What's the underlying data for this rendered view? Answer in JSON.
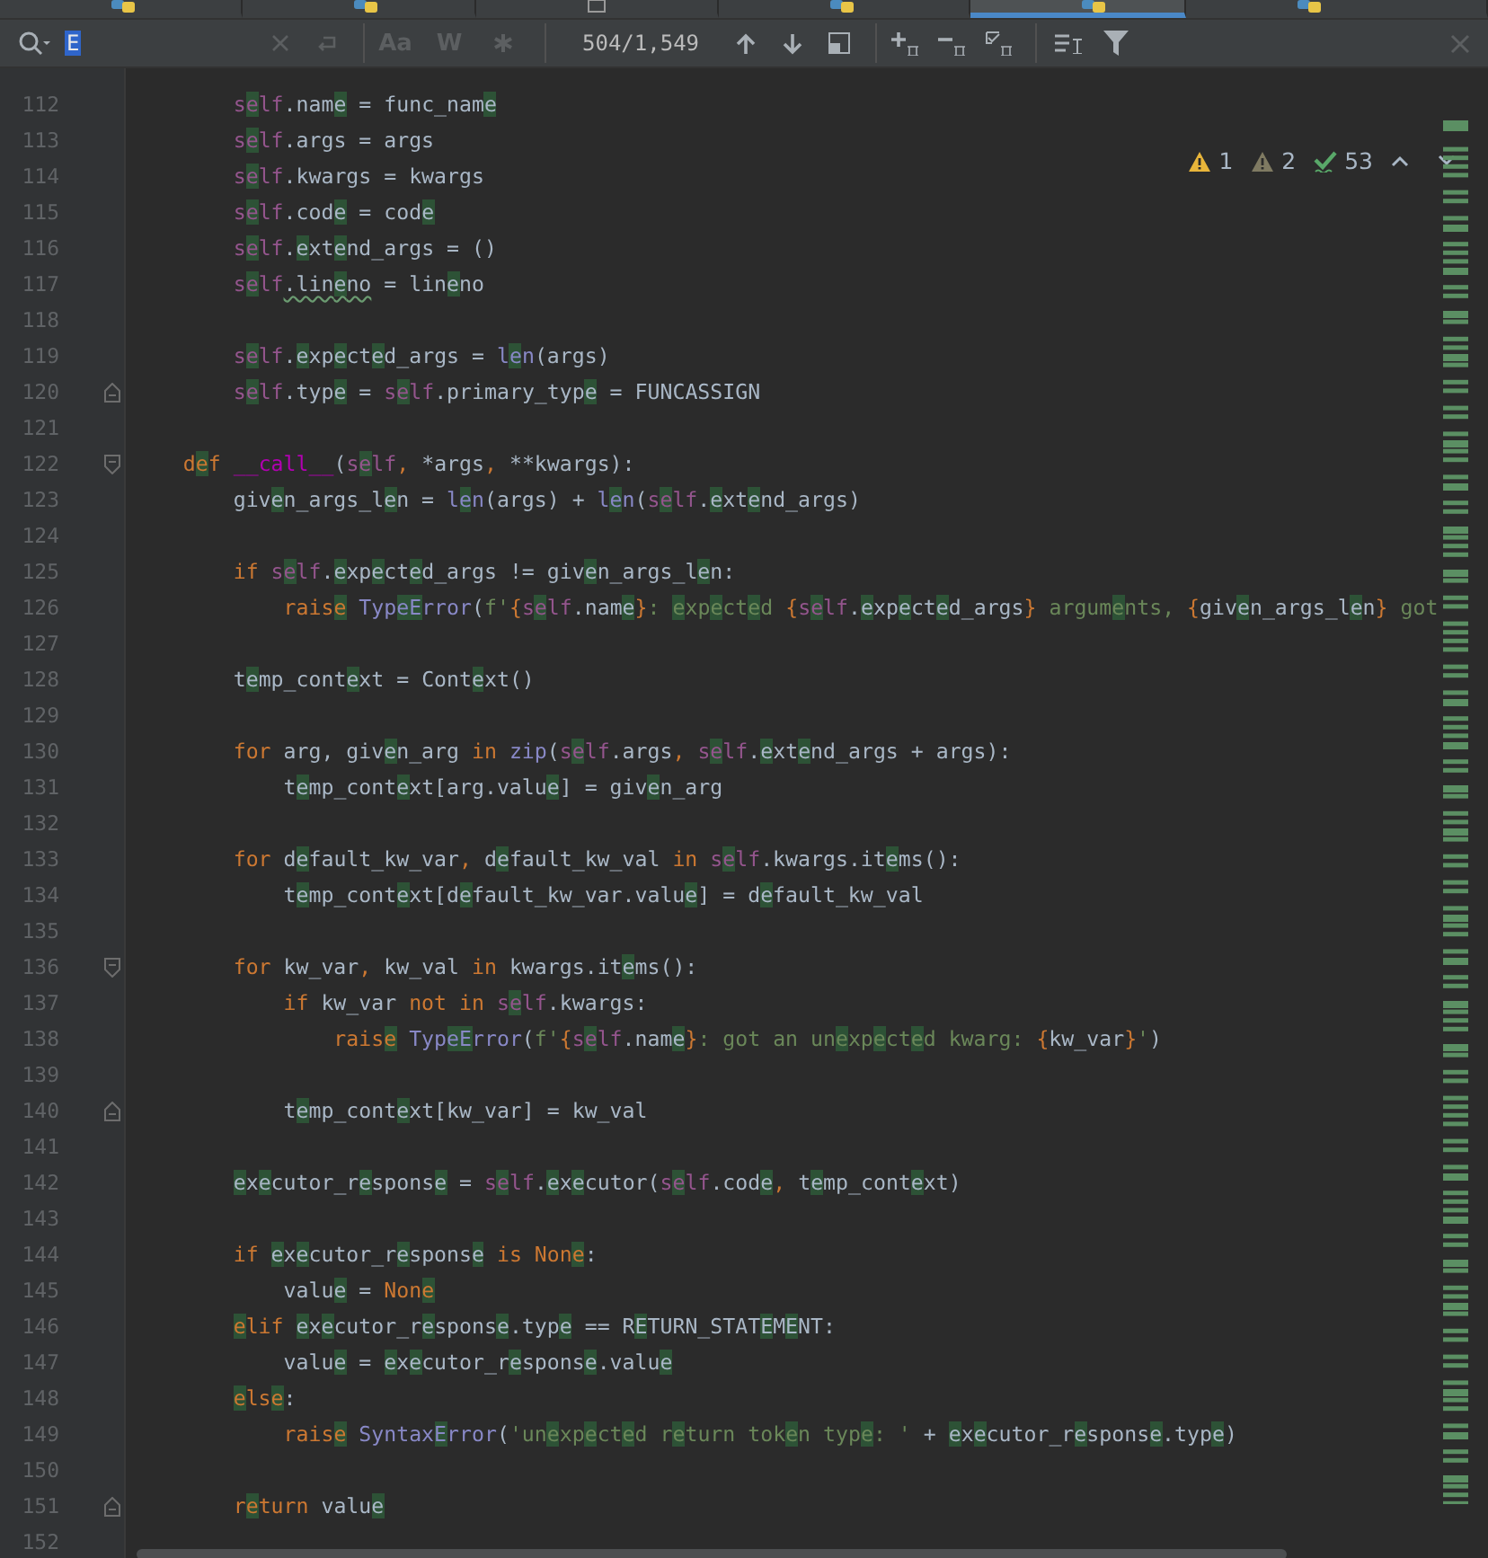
{
  "tabs": [
    {
      "kind": "python",
      "selected": false
    },
    {
      "kind": "python",
      "selected": false
    },
    {
      "kind": "text",
      "selected": false
    },
    {
      "kind": "python",
      "selected": false
    },
    {
      "kind": "python",
      "selected": true
    },
    {
      "kind": "python",
      "selected": false
    }
  ],
  "search": {
    "value": "E",
    "options": [
      {
        "kind": "text",
        "label": "Aa",
        "on": false
      },
      {
        "kind": "text",
        "label": "W",
        "on": false
      },
      {
        "kind": "regex",
        "on": false
      }
    ],
    "counter": "504/1,549"
  },
  "inspections": [
    {
      "kind": "warning",
      "count": "1"
    },
    {
      "kind": "weak",
      "count": "2"
    },
    {
      "kind": "typo",
      "count": "53"
    }
  ],
  "lines": [
    {
      "number": "112",
      "tokens": [
        {
          "kind": "self",
          "text": "        self"
        },
        {
          "kind": "plain",
          "text": ".name = func_name"
        }
      ]
    },
    {
      "number": "113",
      "tokens": [
        {
          "kind": "self",
          "text": "        self"
        },
        {
          "kind": "plain",
          "text": ".args = args"
        }
      ]
    },
    {
      "number": "114",
      "tokens": [
        {
          "kind": "self",
          "text": "        self"
        },
        {
          "kind": "plain",
          "text": ".kwargs = kwargs"
        }
      ]
    },
    {
      "number": "115",
      "tokens": [
        {
          "kind": "self",
          "text": "        self"
        },
        {
          "kind": "plain",
          "text": ".code = code"
        }
      ]
    },
    {
      "number": "116",
      "tokens": [
        {
          "kind": "self",
          "text": "        self"
        },
        {
          "kind": "plain",
          "text": ".extend_args = ()"
        }
      ]
    },
    {
      "number": "117",
      "tokens": [
        {
          "kind": "self",
          "text": "        self"
        },
        {
          "kind": "warn",
          "text": ".lineno"
        },
        {
          "kind": "plain",
          "text": " = lineno"
        }
      ]
    },
    {
      "number": "118"
    },
    {
      "number": "119",
      "tokens": [
        {
          "kind": "self",
          "text": "        self"
        },
        {
          "kind": "plain",
          "text": ".expected_args = "
        },
        {
          "kind": "builtin",
          "text": "len"
        },
        {
          "kind": "plain",
          "text": "(args)"
        }
      ]
    },
    {
      "number": "120",
      "kind": "fold-end",
      "tokens": [
        {
          "kind": "self",
          "text": "        self"
        },
        {
          "kind": "plain",
          "text": ".type = "
        },
        {
          "kind": "self",
          "text": "self"
        },
        {
          "kind": "plain",
          "text": ".primary_type = FUNCASSIGN"
        }
      ]
    },
    {
      "number": "121"
    },
    {
      "number": "122",
      "kind": "fold-start",
      "tokens": [
        {
          "kind": "keyword",
          "text": "    def "
        },
        {
          "kind": "magic",
          "text": "__call__"
        },
        {
          "kind": "plain",
          "text": "("
        },
        {
          "kind": "self",
          "text": "self"
        },
        {
          "kind": "keyword",
          "text": ", "
        },
        {
          "kind": "plain",
          "text": "*args"
        },
        {
          "kind": "keyword",
          "text": ", "
        },
        {
          "kind": "plain",
          "text": "**kwargs):"
        }
      ]
    },
    {
      "number": "123",
      "tokens": [
        {
          "kind": "plain",
          "text": "        given_args_len = "
        },
        {
          "kind": "builtin",
          "text": "len"
        },
        {
          "kind": "plain",
          "text": "(args) + "
        },
        {
          "kind": "builtin",
          "text": "len"
        },
        {
          "kind": "plain",
          "text": "("
        },
        {
          "kind": "self",
          "text": "self"
        },
        {
          "kind": "plain",
          "text": ".extend_args)"
        }
      ]
    },
    {
      "number": "124"
    },
    {
      "number": "125",
      "tokens": [
        {
          "kind": "keyword",
          "text": "        if "
        },
        {
          "kind": "self",
          "text": "self"
        },
        {
          "kind": "plain",
          "text": ".expected_args != given_args_len:"
        }
      ]
    },
    {
      "number": "126",
      "tokens": [
        {
          "kind": "keyword",
          "text": "            raise "
        },
        {
          "kind": "builtin",
          "text": "TypeError"
        },
        {
          "kind": "plain",
          "text": "("
        },
        {
          "kind": "string",
          "text": "f'"
        },
        {
          "kind": "keyword",
          "text": "{"
        },
        {
          "kind": "self",
          "text": "self"
        },
        {
          "kind": "plain",
          "text": ".name"
        },
        {
          "kind": "keyword",
          "text": "}"
        },
        {
          "kind": "string",
          "text": ": expected "
        },
        {
          "kind": "keyword",
          "text": "{"
        },
        {
          "kind": "self",
          "text": "self"
        },
        {
          "kind": "plain",
          "text": ".expected_args"
        },
        {
          "kind": "keyword",
          "text": "}"
        },
        {
          "kind": "string",
          "text": " arguments, "
        },
        {
          "kind": "keyword",
          "text": "{"
        },
        {
          "kind": "plain",
          "text": "given_args_len"
        },
        {
          "kind": "keyword",
          "text": "}"
        },
        {
          "kind": "string",
          "text": " got"
        }
      ]
    },
    {
      "number": "127"
    },
    {
      "number": "128",
      "tokens": [
        {
          "kind": "plain",
          "text": "        temp_context = Context()"
        }
      ]
    },
    {
      "number": "129"
    },
    {
      "number": "130",
      "tokens": [
        {
          "kind": "keyword",
          "text": "        for "
        },
        {
          "kind": "plain",
          "text": "arg, given_arg "
        },
        {
          "kind": "keyword",
          "text": "in "
        },
        {
          "kind": "builtin",
          "text": "zip"
        },
        {
          "kind": "plain",
          "text": "("
        },
        {
          "kind": "self",
          "text": "self"
        },
        {
          "kind": "plain",
          "text": ".args"
        },
        {
          "kind": "keyword",
          "text": ", "
        },
        {
          "kind": "self",
          "text": "self"
        },
        {
          "kind": "plain",
          "text": ".extend_args + args):"
        }
      ]
    },
    {
      "number": "131",
      "tokens": [
        {
          "kind": "plain",
          "text": "            temp_context[arg.value] = given_arg"
        }
      ]
    },
    {
      "number": "132"
    },
    {
      "number": "133",
      "tokens": [
        {
          "kind": "keyword",
          "text": "        for "
        },
        {
          "kind": "plain",
          "text": "default_kw_var"
        },
        {
          "kind": "keyword",
          "text": ", "
        },
        {
          "kind": "plain",
          "text": "default_kw_val "
        },
        {
          "kind": "keyword",
          "text": "in "
        },
        {
          "kind": "self",
          "text": "self"
        },
        {
          "kind": "plain",
          "text": ".kwargs.items():"
        }
      ]
    },
    {
      "number": "134",
      "tokens": [
        {
          "kind": "plain",
          "text": "            temp_context[default_kw_var.value] = default_kw_val"
        }
      ]
    },
    {
      "number": "135"
    },
    {
      "number": "136",
      "kind": "fold-start",
      "tokens": [
        {
          "kind": "keyword",
          "text": "        for "
        },
        {
          "kind": "plain",
          "text": "kw_var"
        },
        {
          "kind": "keyword",
          "text": ", "
        },
        {
          "kind": "plain",
          "text": "kw_val "
        },
        {
          "kind": "keyword",
          "text": "in "
        },
        {
          "kind": "plain",
          "text": "kwargs.items():"
        }
      ]
    },
    {
      "number": "137",
      "tokens": [
        {
          "kind": "keyword",
          "text": "            if "
        },
        {
          "kind": "plain",
          "text": "kw_var "
        },
        {
          "kind": "keyword",
          "text": "not in "
        },
        {
          "kind": "self",
          "text": "self"
        },
        {
          "kind": "plain",
          "text": ".kwargs:"
        }
      ]
    },
    {
      "number": "138",
      "tokens": [
        {
          "kind": "keyword",
          "text": "                raise "
        },
        {
          "kind": "builtin",
          "text": "TypeError"
        },
        {
          "kind": "plain",
          "text": "("
        },
        {
          "kind": "string",
          "text": "f'"
        },
        {
          "kind": "keyword",
          "text": "{"
        },
        {
          "kind": "self",
          "text": "self"
        },
        {
          "kind": "plain",
          "text": ".name"
        },
        {
          "kind": "keyword",
          "text": "}"
        },
        {
          "kind": "string",
          "text": ": got an unexpected kwarg: "
        },
        {
          "kind": "keyword",
          "text": "{"
        },
        {
          "kind": "plain",
          "text": "kw_var"
        },
        {
          "kind": "keyword",
          "text": "}"
        },
        {
          "kind": "string",
          "text": "'"
        },
        {
          "kind": "plain",
          "text": ")"
        }
      ]
    },
    {
      "number": "139"
    },
    {
      "number": "140",
      "kind": "fold-end",
      "tokens": [
        {
          "kind": "plain",
          "text": "            temp_context[kw_var] = kw_val"
        }
      ]
    },
    {
      "number": "141"
    },
    {
      "number": "142",
      "tokens": [
        {
          "kind": "plain",
          "text": "        executor_response = "
        },
        {
          "kind": "self",
          "text": "self"
        },
        {
          "kind": "plain",
          "text": ".executor("
        },
        {
          "kind": "self",
          "text": "self"
        },
        {
          "kind": "plain",
          "text": ".code"
        },
        {
          "kind": "keyword",
          "text": ", "
        },
        {
          "kind": "plain",
          "text": "temp_context)"
        }
      ]
    },
    {
      "number": "143"
    },
    {
      "number": "144",
      "tokens": [
        {
          "kind": "keyword",
          "text": "        if "
        },
        {
          "kind": "plain",
          "text": "executor_response "
        },
        {
          "kind": "keyword",
          "text": "is None"
        },
        {
          "kind": "plain",
          "text": ":"
        }
      ]
    },
    {
      "number": "145",
      "tokens": [
        {
          "kind": "plain",
          "text": "            value = "
        },
        {
          "kind": "keyword",
          "text": "None"
        }
      ]
    },
    {
      "number": "146",
      "tokens": [
        {
          "kind": "keyword",
          "text": "        elif "
        },
        {
          "kind": "plain",
          "text": "executor_response.type == RETURN_STATEMENT:"
        }
      ]
    },
    {
      "number": "147",
      "tokens": [
        {
          "kind": "plain",
          "text": "            value = executor_response.value"
        }
      ]
    },
    {
      "number": "148",
      "tokens": [
        {
          "kind": "keyword",
          "text": "        else"
        },
        {
          "kind": "plain",
          "text": ":"
        }
      ]
    },
    {
      "number": "149",
      "tokens": [
        {
          "kind": "keyword",
          "text": "            raise "
        },
        {
          "kind": "builtin",
          "text": "SyntaxError"
        },
        {
          "kind": "plain",
          "text": "("
        },
        {
          "kind": "string",
          "text": "'unexpected return token type: '"
        },
        {
          "kind": "plain",
          "text": " + executor_response.type)"
        }
      ]
    },
    {
      "number": "150"
    },
    {
      "number": "151",
      "kind": "fold-end",
      "tokens": [
        {
          "kind": "keyword",
          "text": "        return "
        },
        {
          "kind": "plain",
          "text": "value"
        }
      ]
    },
    {
      "number": "152"
    }
  ]
}
